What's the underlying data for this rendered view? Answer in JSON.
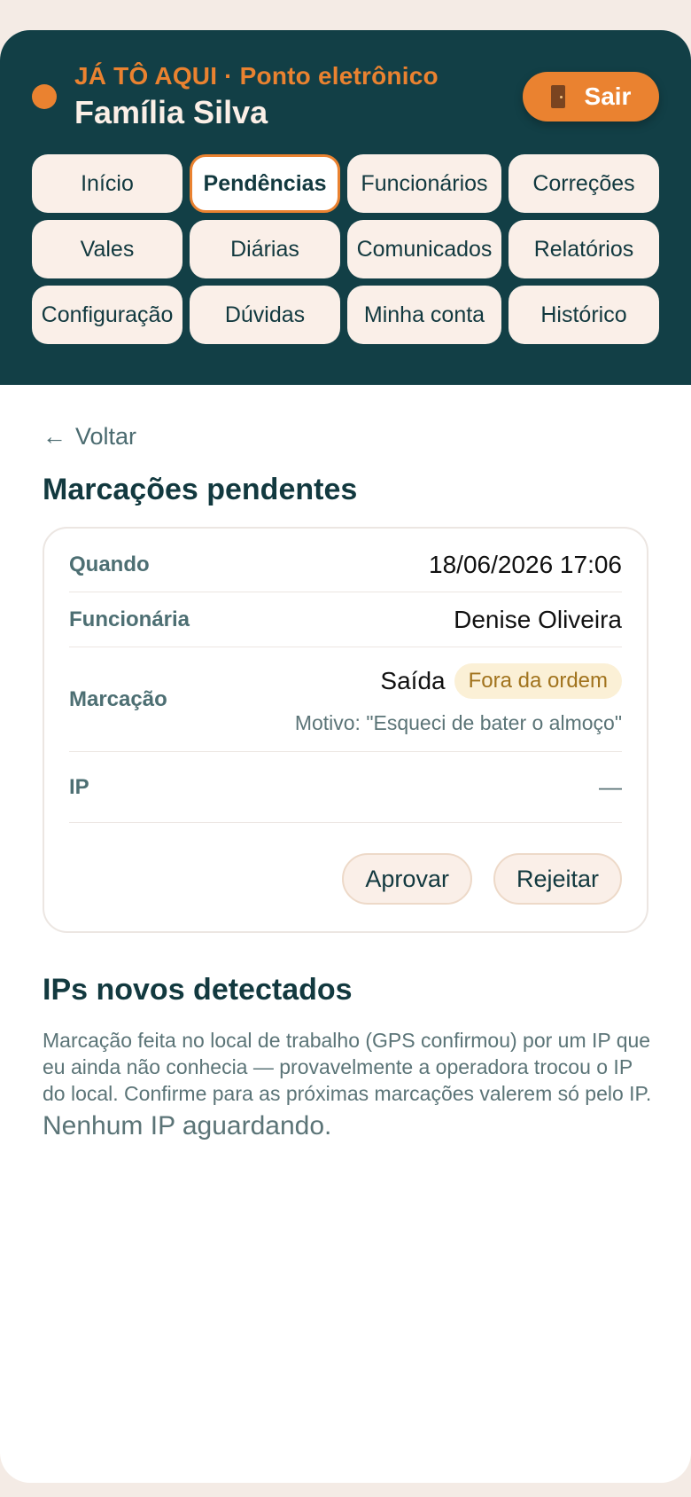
{
  "header": {
    "tagline": "JÁ TÔ AQUI · Ponto eletrônico",
    "family": "Família Silva",
    "logout_label": "Sair"
  },
  "nav": {
    "items": [
      {
        "label": "Início"
      },
      {
        "label": "Pendências"
      },
      {
        "label": "Funcionários"
      },
      {
        "label": "Correções"
      },
      {
        "label": "Vales"
      },
      {
        "label": "Diárias"
      },
      {
        "label": "Comunicados"
      },
      {
        "label": "Relatórios"
      },
      {
        "label": "Configuração"
      },
      {
        "label": "Dúvidas"
      },
      {
        "label": "Minha conta"
      },
      {
        "label": "Histórico"
      }
    ],
    "active": "Pendências"
  },
  "content": {
    "back_label": "Voltar",
    "pending_title": "Marcações pendentes",
    "card": {
      "when_label": "Quando",
      "when_value": "18/06/2026 17:06",
      "employee_label": "Funcionária",
      "employee_value": "Denise Oliveira",
      "mark_label": "Marcação",
      "mark_value": "Saída",
      "mark_badge": "Fora da ordem",
      "reason": "Motivo: \"Esqueci de bater o almoço\"",
      "ip_label": "IP",
      "ip_value": "—",
      "approve_label": "Aprovar",
      "reject_label": "Rejeitar"
    },
    "ips_title": "IPs novos detectados",
    "ips_description": "Marcação feita no local de trabalho (GPS confirmou) por um IP que eu ainda não conhecia — provavelmente a operadora trocou o IP do local. Confirme para as próximas marcações valerem só pelo IP.",
    "ips_empty": "Nenhum IP aguardando."
  },
  "colors": {
    "header_bg": "#123f46",
    "accent": "#ea8230",
    "nav_bg": "#faefe8",
    "badge_bg": "#fbf0d6"
  }
}
